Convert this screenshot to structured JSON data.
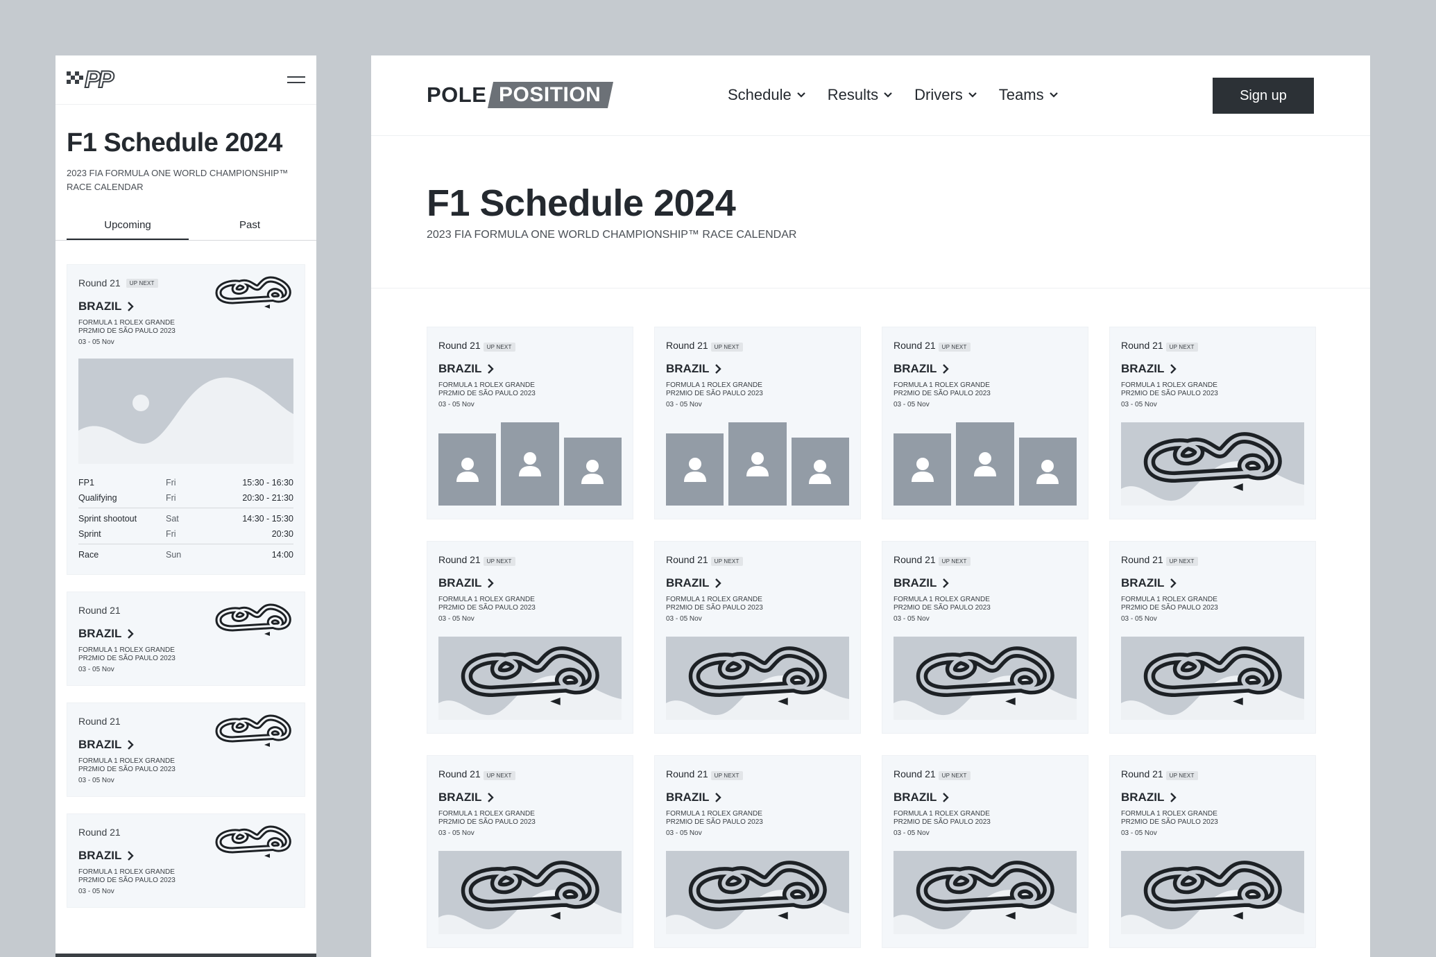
{
  "colors": {
    "background": "#c5cacf",
    "card": "#f4f7fa",
    "dark": "#2c3136",
    "placeholder": "#c5cbd2",
    "avatar": "#939ca6"
  },
  "mobile": {
    "logo_text": "PP",
    "menu_icon": "hamburger-icon",
    "title": "F1 Schedule 2024",
    "subtitle": "2023 FIA FORMULA ONE WORLD CHAMPIONSHIP™ RACE CALENDAR",
    "tabs": [
      {
        "label": "Upcoming",
        "active": true
      },
      {
        "label": "Past",
        "active": false
      }
    ],
    "featured": {
      "round": "Round 21",
      "badge": "UP NEXT",
      "country": "BRAZIL",
      "race_name": "FORMULA 1 ROLEX GRANDE PR2MIO DE SÃO PAULO 2023",
      "date": "03 - 05 Nov",
      "sessions": [
        {
          "name": "FP1",
          "day": "Fri",
          "time": "15:30 - 16:30"
        },
        {
          "name": "Qualifying",
          "day": "Fri",
          "time": "20:30 - 21:30"
        },
        {
          "name": "Sprint shootout",
          "day": "Sat",
          "time": "14:30 - 15:30"
        },
        {
          "name": "Sprint",
          "day": "Fri",
          "time": "20:30"
        },
        {
          "name": "Race",
          "day": "Sun",
          "time": "14:00"
        }
      ]
    },
    "cards": [
      {
        "round": "Round 21",
        "country": "BRAZIL",
        "race_name": "FORMULA 1 ROLEX GRANDE PR2MIO DE SÃO PAULO 2023",
        "date": "03 - 05 Nov"
      },
      {
        "round": "Round 21",
        "country": "BRAZIL",
        "race_name": "FORMULA 1 ROLEX GRANDE PR2MIO DE SÃO PAULO 2023",
        "date": "03 - 05 Nov"
      },
      {
        "round": "Round 21",
        "country": "BRAZIL",
        "race_name": "FORMULA 1 ROLEX GRANDE PR2MIO DE SÃO PAULO 2023",
        "date": "03 - 05 Nov"
      }
    ]
  },
  "desktop": {
    "logo": {
      "pole": "POLE",
      "position": "POSITION"
    },
    "nav": [
      "Schedule",
      "Results",
      "Drivers",
      "Teams"
    ],
    "signup": "Sign up",
    "title": "F1 Schedule 2024",
    "subtitle": "2023 FIA FORMULA ONE WORLD CHAMPIONSHIP™ RACE CALENDAR",
    "cards": [
      {
        "round": "Round 21",
        "badge": "UP NEXT",
        "country": "BRAZIL",
        "race_name": "FORMULA 1 ROLEX GRANDE PR2MIO DE SÃO PAULO 2023",
        "date": "03 - 05 Nov",
        "media": "drivers"
      },
      {
        "round": "Round 21",
        "badge": "UP NEXT",
        "country": "BRAZIL",
        "race_name": "FORMULA 1 ROLEX GRANDE PR2MIO DE SÃO PAULO 2023",
        "date": "03 - 05 Nov",
        "media": "drivers"
      },
      {
        "round": "Round 21",
        "badge": "UP NEXT",
        "country": "BRAZIL",
        "race_name": "FORMULA 1 ROLEX GRANDE PR2MIO DE SÃO PAULO 2023",
        "date": "03 - 05 Nov",
        "media": "drivers"
      },
      {
        "round": "Round 21",
        "badge": "UP NEXT",
        "country": "BRAZIL",
        "race_name": "FORMULA 1 ROLEX GRANDE PR2MIO DE SÃO PAULO 2023",
        "date": "03 - 05 Nov",
        "media": "track"
      },
      {
        "round": "Round 21",
        "badge": "UP NEXT",
        "country": "BRAZIL",
        "race_name": "FORMULA 1 ROLEX GRANDE PR2MIO DE SÃO PAULO 2023",
        "date": "03 - 05 Nov",
        "media": "track"
      },
      {
        "round": "Round 21",
        "badge": "UP NEXT",
        "country": "BRAZIL",
        "race_name": "FORMULA 1 ROLEX GRANDE PR2MIO DE SÃO PAULO 2023",
        "date": "03 - 05 Nov",
        "media": "track"
      },
      {
        "round": "Round 21",
        "badge": "UP NEXT",
        "country": "BRAZIL",
        "race_name": "FORMULA 1 ROLEX GRANDE PR2MIO DE SÃO PAULO 2023",
        "date": "03 - 05 Nov",
        "media": "track"
      },
      {
        "round": "Round 21",
        "badge": "UP NEXT",
        "country": "BRAZIL",
        "race_name": "FORMULA 1 ROLEX GRANDE PR2MIO DE SÃO PAULO 2023",
        "date": "03 - 05 Nov",
        "media": "track"
      },
      {
        "round": "Round 21",
        "badge": "UP NEXT",
        "country": "BRAZIL",
        "race_name": "FORMULA 1 ROLEX GRANDE PR2MIO DE SÃO PAULO 2023",
        "date": "03 - 05 Nov",
        "media": "track"
      },
      {
        "round": "Round 21",
        "badge": "UP NEXT",
        "country": "BRAZIL",
        "race_name": "FORMULA 1 ROLEX GRANDE PR2MIO DE SÃO PAULO 2023",
        "date": "03 - 05 Nov",
        "media": "track"
      },
      {
        "round": "Round 21",
        "badge": "UP NEXT",
        "country": "BRAZIL",
        "race_name": "FORMULA 1 ROLEX GRANDE PR2MIO DE SÃO PAULO 2023",
        "date": "03 - 05 Nov",
        "media": "track"
      },
      {
        "round": "Round 21",
        "badge": "UP NEXT",
        "country": "BRAZIL",
        "race_name": "FORMULA 1 ROLEX GRANDE PR2MIO DE SÃO PAULO 2023",
        "date": "03 - 05 Nov",
        "media": "track"
      }
    ]
  }
}
